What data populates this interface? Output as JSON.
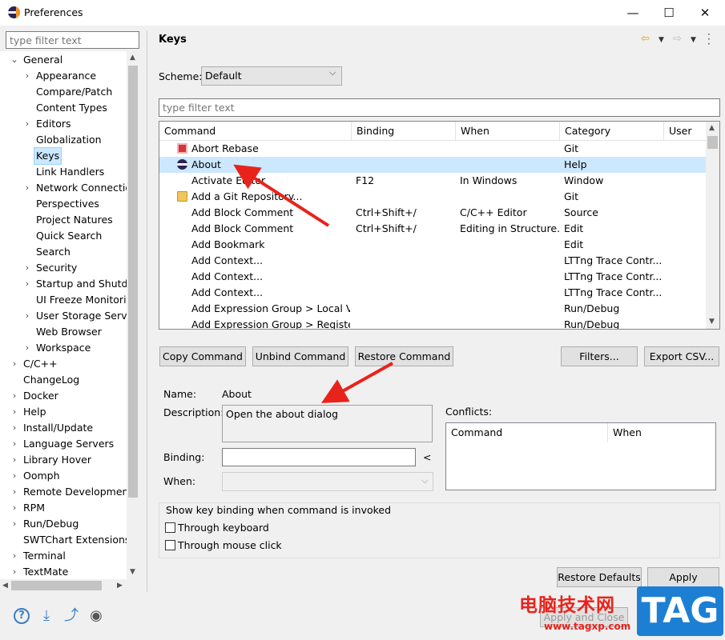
{
  "window": {
    "title": "Preferences",
    "minimize": "—",
    "maximize": "☐",
    "close": "✕"
  },
  "sidebar": {
    "filter_placeholder": "type filter text",
    "tree": [
      {
        "label": "General",
        "level": 0,
        "twisty": "expanded"
      },
      {
        "label": "Appearance",
        "level": 1,
        "twisty": "collapsed"
      },
      {
        "label": "Compare/Patch",
        "level": 1,
        "twisty": "none"
      },
      {
        "label": "Content Types",
        "level": 1,
        "twisty": "none"
      },
      {
        "label": "Editors",
        "level": 1,
        "twisty": "collapsed"
      },
      {
        "label": "Globalization",
        "level": 1,
        "twisty": "none"
      },
      {
        "label": "Keys",
        "level": 1,
        "twisty": "none",
        "selected": true
      },
      {
        "label": "Link Handlers",
        "level": 1,
        "twisty": "none"
      },
      {
        "label": "Network Connectio",
        "level": 1,
        "twisty": "collapsed"
      },
      {
        "label": "Perspectives",
        "level": 1,
        "twisty": "none"
      },
      {
        "label": "Project Natures",
        "level": 1,
        "twisty": "none"
      },
      {
        "label": "Quick Search",
        "level": 1,
        "twisty": "none"
      },
      {
        "label": "Search",
        "level": 1,
        "twisty": "none"
      },
      {
        "label": "Security",
        "level": 1,
        "twisty": "collapsed"
      },
      {
        "label": "Startup and Shutdo",
        "level": 1,
        "twisty": "collapsed"
      },
      {
        "label": "UI Freeze Monitorir",
        "level": 1,
        "twisty": "none"
      },
      {
        "label": "User Storage Servic",
        "level": 1,
        "twisty": "collapsed"
      },
      {
        "label": "Web Browser",
        "level": 1,
        "twisty": "none"
      },
      {
        "label": "Workspace",
        "level": 1,
        "twisty": "collapsed"
      },
      {
        "label": "C/C++",
        "level": 0,
        "twisty": "collapsed"
      },
      {
        "label": "ChangeLog",
        "level": 0,
        "twisty": "none"
      },
      {
        "label": "Docker",
        "level": 0,
        "twisty": "collapsed"
      },
      {
        "label": "Help",
        "level": 0,
        "twisty": "collapsed"
      },
      {
        "label": "Install/Update",
        "level": 0,
        "twisty": "collapsed"
      },
      {
        "label": "Language Servers",
        "level": 0,
        "twisty": "collapsed"
      },
      {
        "label": "Library Hover",
        "level": 0,
        "twisty": "collapsed"
      },
      {
        "label": "Oomph",
        "level": 0,
        "twisty": "collapsed"
      },
      {
        "label": "Remote Development",
        "level": 0,
        "twisty": "collapsed"
      },
      {
        "label": "RPM",
        "level": 0,
        "twisty": "collapsed"
      },
      {
        "label": "Run/Debug",
        "level": 0,
        "twisty": "collapsed"
      },
      {
        "label": "SWTChart Extensions",
        "level": 0,
        "twisty": "none"
      },
      {
        "label": "Terminal",
        "level": 0,
        "twisty": "collapsed"
      },
      {
        "label": "TextMate",
        "level": 0,
        "twisty": "collapsed"
      }
    ]
  },
  "page": {
    "title": "Keys",
    "scheme_label": "Scheme:",
    "scheme_value": "Default",
    "filter_placeholder": "type filter text",
    "columns": [
      "Command",
      "Binding",
      "When",
      "Category",
      "User"
    ],
    "rows": [
      {
        "command": "Abort Rebase",
        "binding": "",
        "when": "",
        "category": "Git",
        "user": "",
        "icon": "git-red-icon"
      },
      {
        "command": "About",
        "binding": "",
        "when": "",
        "category": "Help",
        "user": "",
        "icon": "eclipse-icon",
        "selected": true
      },
      {
        "command": "Activate Editor",
        "binding": "F12",
        "when": "In Windows",
        "category": "Window",
        "user": "",
        "icon": ""
      },
      {
        "command": "Add a Git Repository...",
        "binding": "",
        "when": "",
        "category": "Git",
        "user": "",
        "icon": "git-repo-icon"
      },
      {
        "command": "Add Block Comment",
        "binding": "Ctrl+Shift+/",
        "when": "C/C++ Editor",
        "category": "Source",
        "user": "",
        "icon": ""
      },
      {
        "command": "Add Block Comment",
        "binding": "Ctrl+Shift+/",
        "when": "Editing in Structure...",
        "category": "Edit",
        "user": "",
        "icon": ""
      },
      {
        "command": "Add Bookmark",
        "binding": "",
        "when": "",
        "category": "Edit",
        "user": "",
        "icon": ""
      },
      {
        "command": "Add Context...",
        "binding": "",
        "when": "",
        "category": "LTTng Trace Contr...",
        "user": "",
        "icon": ""
      },
      {
        "command": "Add Context...",
        "binding": "",
        "when": "",
        "category": "LTTng Trace Contr...",
        "user": "",
        "icon": ""
      },
      {
        "command": "Add Context...",
        "binding": "",
        "when": "",
        "category": "LTTng Trace Contr...",
        "user": "",
        "icon": ""
      },
      {
        "command": "Add Expression Group > Local Var",
        "binding": "",
        "when": "",
        "category": "Run/Debug",
        "user": "",
        "icon": ""
      },
      {
        "command": "Add Expression Group > Registers",
        "binding": "",
        "when": "",
        "category": "Run/Debug",
        "user": "",
        "icon": ""
      }
    ],
    "buttons": {
      "copy": "Copy Command",
      "unbind": "Unbind Command",
      "restore": "Restore Command",
      "filters": "Filters...",
      "export": "Export CSV..."
    },
    "details": {
      "name_label": "Name:",
      "name_value": "About",
      "description_label": "Description:",
      "description_value": "Open the about dialog",
      "binding_label": "Binding:",
      "binding_hint": "<",
      "when_label": "When:",
      "conflicts_label": "Conflicts:",
      "conflicts_columns": [
        "Command",
        "When"
      ]
    },
    "show_binding": {
      "title": "Show key binding when command is invoked",
      "through_keyboard": "Through keyboard",
      "through_mouse": "Through mouse click"
    },
    "restore_defaults": "Restore Defaults",
    "apply": "Apply"
  },
  "bottom": {
    "apply_and_close": "Apply and Close"
  },
  "watermark": {
    "cn": "电脑技术网",
    "url": "www.tagxp.com",
    "tag": "TAG"
  },
  "colors": {
    "selection": "#cce8ff",
    "arrow": "#e8231c",
    "tag_blue": "#1d7fd4"
  }
}
